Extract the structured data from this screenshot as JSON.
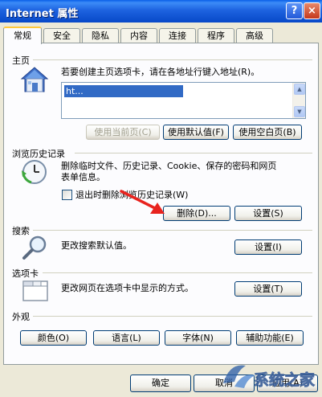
{
  "window": {
    "title": "Internet 属性",
    "help_button": "?",
    "close_button": "×"
  },
  "tabs": [
    {
      "label": "常规",
      "active": true
    },
    {
      "label": "安全",
      "active": false
    },
    {
      "label": "隐私",
      "active": false
    },
    {
      "label": "内容",
      "active": false
    },
    {
      "label": "连接",
      "active": false
    },
    {
      "label": "程序",
      "active": false
    },
    {
      "label": "高级",
      "active": false
    }
  ],
  "home_page": {
    "title": "主页",
    "description": "若要创建主页选项卡，请在各地址行键入地址(R)。",
    "url_value": "ht...",
    "buttons": {
      "use_current": "使用当前页(C)",
      "use_default": "使用默认值(F)",
      "use_blank": "使用空白页(B)"
    }
  },
  "browsing_history": {
    "title": "浏览历史记录",
    "description_line1": "删除临时文件、历史记录、Cookie、保存的密码和网页",
    "description_line2": "表单信息。",
    "checkbox_label": "退出时删除浏览历史记录(W)",
    "checkbox_checked": false,
    "delete_button": "删除(D)...",
    "settings_button": "设置(S)"
  },
  "search": {
    "title": "搜索",
    "description": "更改搜索默认值。",
    "settings_button": "设置(I)"
  },
  "tabs_section": {
    "title": "选项卡",
    "description": "更改网页在选项卡中显示的方式。",
    "settings_button": "设置(T)"
  },
  "appearance": {
    "title": "外观",
    "buttons": {
      "colors": "颜色(O)",
      "languages": "语言(L)",
      "fonts": "字体(N)",
      "accessibility": "辅助功能(E)"
    }
  },
  "footer": {
    "ok": "确定",
    "cancel": "取消",
    "apply": "应用(A)"
  },
  "watermark": {
    "text": "系统之家"
  },
  "colors": {
    "titlebar": "#0A5FE8",
    "dialog_bg": "#ECE9D8",
    "panel_bg": "#FCFCFE",
    "active_tab_accent": "#FFC83C",
    "annotation_arrow": "#E8231E"
  }
}
